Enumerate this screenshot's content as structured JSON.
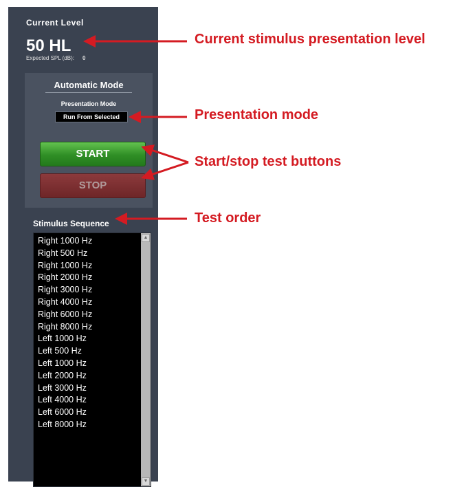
{
  "panel": {
    "current_level_label": "Current  Level",
    "current_level_value": "50 HL",
    "expected_spl_label": "Expected SPL (dB):",
    "expected_spl_value": "0",
    "automatic_mode": {
      "title": "Automatic Mode",
      "presentation_mode_label": "Presentation Mode",
      "presentation_mode_value": "Run From Selected",
      "start_label": "START",
      "stop_label": "STOP"
    },
    "stimulus_sequence_label": "Stimulus Sequence",
    "stimulus_sequence": [
      "Right 1000 Hz",
      "Right 500 Hz",
      "Right 1000 Hz",
      "Right 2000 Hz",
      "Right 3000 Hz",
      "Right 4000 Hz",
      "Right 6000 Hz",
      "Right 8000 Hz",
      "Left 1000 Hz",
      "Left 500 Hz",
      "Left 1000 Hz",
      "Left 2000 Hz",
      "Left 3000 Hz",
      "Left 4000 Hz",
      "Left 6000 Hz",
      "Left 8000 Hz"
    ]
  },
  "annotations": {
    "current_level": "Current stimulus presentation level",
    "presentation_mode": "Presentation mode",
    "start_stop": "Start/stop test buttons",
    "test_order": "Test order"
  },
  "colors": {
    "annotation": "#d41b22",
    "panel": "#3a4250",
    "start": "#3a9a2e",
    "stop": "#7a2c2e"
  },
  "icons": {
    "scroll_up": "scroll-up-arrow-icon",
    "scroll_down": "scroll-down-arrow-icon"
  }
}
